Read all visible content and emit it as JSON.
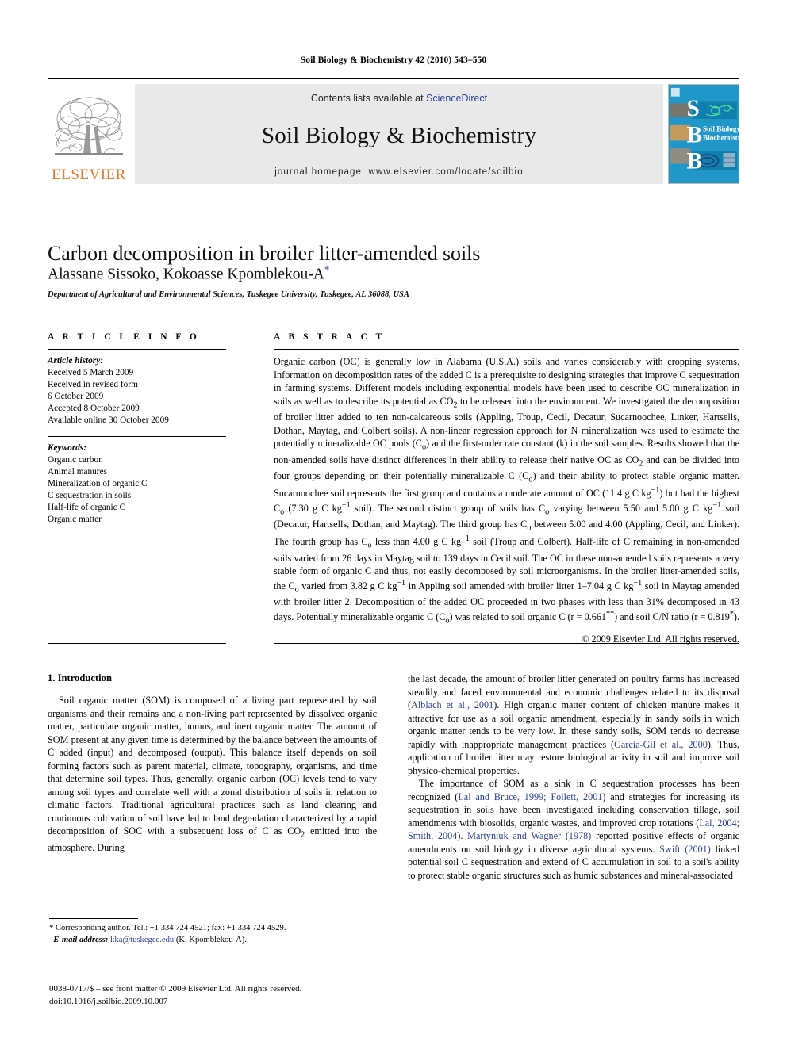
{
  "running_head": "Soil Biology & Biochemistry 42 (2010) 543–550",
  "banner": {
    "publisher_name": "ELSEVIER",
    "contents_prefix": "Contents lists available at",
    "sciencedirect_link": "ScienceDirect",
    "journal_title": "Soil Biology & Biochemistry",
    "homepage_line": "journal homepage: www.elsevier.com/locate/soilbio",
    "cover_letters": [
      "S",
      "B",
      "B"
    ],
    "cover_caption_line1": "Soil Biology &",
    "cover_caption_line2": "Biochemistry",
    "link_color": "#2a3f99",
    "elsevier_orange": "#e87722",
    "banner_grey": "#e9e9e9",
    "cover_blue": "#2196c9"
  },
  "article": {
    "title": "Carbon decomposition in broiler litter-amended soils",
    "authors": "Alassane Sissoko, Kokoasse Kpomblekou-A",
    "corresponding_marker": "*",
    "affiliation": "Department of Agricultural and Environmental Sciences, Tuskegee University, Tuskegee, AL 36088, USA"
  },
  "article_info": {
    "heading": "A R T I C L E   I N F O",
    "history_label": "Article history:",
    "history": [
      "Received 5 March 2009",
      "Received in revised form",
      "6 October 2009",
      "Accepted 8 October 2009",
      "Available online 30 October 2009"
    ],
    "keywords_label": "Keywords:",
    "keywords": [
      "Organic carbon",
      "Animal manures",
      "Mineralization of organic C",
      "C sequestration in soils",
      "Half-life of organic C",
      "Organic matter"
    ]
  },
  "abstract": {
    "heading": "A B S T R A C T",
    "text": "Organic carbon (OC) is generally low in Alabama (U.S.A.) soils and varies considerably with cropping systems. Information on decomposition rates of the added C is a prerequisite to designing strategies that improve C sequestration in farming systems. Different models including exponential models have been used to describe OC mineralization in soils as well as to describe its potential as CO2 to be released into the environment. We investigated the decomposition of broiler litter added to ten non-calcareous soils (Appling, Troup, Cecil, Decatur, Sucarnoochee, Linker, Hartsells, Dothan, Maytag, and Colbert soils). A non-linear regression approach for N mineralization was used to estimate the potentially mineralizable OC pools (Co) and the first-order rate constant (k) in the soil samples. Results showed that the non-amended soils have distinct differences in their ability to release their native OC as CO2 and can be divided into four groups depending on their potentially mineralizable C (Co) and their ability to protect stable organic matter. Sucarnoochee soil represents the first group and contains a moderate amount of OC (11.4 g C kg−1) but had the highest Co (7.30 g C kg−1 soil). The second distinct group of soils has Co varying between 5.50 and 5.00 g C kg−1 soil (Decatur, Hartsells, Dothan, and Maytag). The third group has Co between 5.00 and 4.00 (Appling, Cecil, and Linker). The fourth group has Co less than 4.00 g C kg−1 soil (Troup and Colbert). Half-life of C remaining in non-amended soils varied from 26 days in Maytag soil to 139 days in Cecil soil. The OC in these non-amended soils represents a very stable form of organic C and thus, not easily decomposed by soil microorganisms. In the broiler litter-amended soils, the Co varied from 3.82 g C kg−1 in Appling soil amended with broiler litter 1–7.04 g C kg−1 soil in Maytag amended with broiler litter 2. Decomposition of the added OC proceeded in two phases with less than 31% decomposed in 43 days. Potentially mineralizable organic C (Co) was related to soil organic C (r = 0.661**) and soil C/N ratio (r = 0.819*).",
    "copyright": "© 2009 Elsevier Ltd. All rights reserved."
  },
  "body": {
    "section_number_title": "1.  Introduction",
    "left_paragraph": "Soil organic matter (SOM) is composed of a living part represented by soil organisms and their remains and a non-living part represented by dissolved organic matter, particulate organic matter, humus, and inert organic matter. The amount of SOM present at any given time is determined by the balance between the amounts of C added (input) and decomposed (output). This balance itself depends on soil forming factors such as parent material, climate, topography, organisms, and time that determine soil types. Thus, generally, organic carbon (OC) levels tend to vary among soil types and correlate well with a zonal distribution of soils in relation to climatic factors. Traditional agricultural practices such as land clearing and continuous cultivation of soil have led to land degradation characterized by a rapid decomposition of SOC with a subsequent loss of C as CO2 emitted into the atmosphere. During",
    "right_paragraph_1_part1": "the last decade, the amount of broiler litter generated on poultry farms has increased steadily and faced environmental and economic challenges related to its disposal (",
    "right_cite_1": "Alblach et al., 2001",
    "right_paragraph_1_part2": "). High organic matter content of chicken manure makes it attractive for use as a soil organic amendment, especially in sandy soils in which organic matter tends to be very low. In these sandy soils, SOM tends to decrease rapidly with inappropriate management practices (",
    "right_cite_2": "Garcia-Gil et al., 2000",
    "right_paragraph_1_part3": "). Thus, application of broiler litter may restore biological activity in soil and improve soil physico-chemical properties.",
    "right_paragraph_2_part1": "The importance of SOM as a sink in C sequestration processes has been recognized (",
    "right_cite_3": "Lal and Bruce, 1999; Follett, 2001",
    "right_paragraph_2_part2": ") and strategies for increasing its sequestration in soils have been investigated including conservation tillage, soil amendments with biosolids, organic wastes, and improved crop rotations (",
    "right_cite_4": "Lal, 2004; Smith, 2004",
    "right_paragraph_2_part3": "). ",
    "right_cite_5": "Martyniuk and Wagner (1978)",
    "right_paragraph_2_part4": " reported positive effects of organic amendments on soil biology in diverse agricultural systems. ",
    "right_cite_6": "Swift (2001)",
    "right_paragraph_2_part5": " linked potential soil C sequestration and extend of C accumulation in soil to a soil's ability to protect stable organic structures such as humic substances and mineral-associated"
  },
  "footnote": {
    "marker": "*",
    "corresponding": "Corresponding author. Tel.: +1 334 724 4521; fax: +1 334 724 4529.",
    "email_label": "E-mail address:",
    "email": "kka@tuskegee.edu",
    "email_owner": "(K. Kpomblekou-A)."
  },
  "footer": {
    "issn_line": "0038-0717/$ – see front matter © 2009 Elsevier Ltd. All rights reserved.",
    "doi_line": "doi:10.1016/j.soilbio.2009.10.007"
  }
}
